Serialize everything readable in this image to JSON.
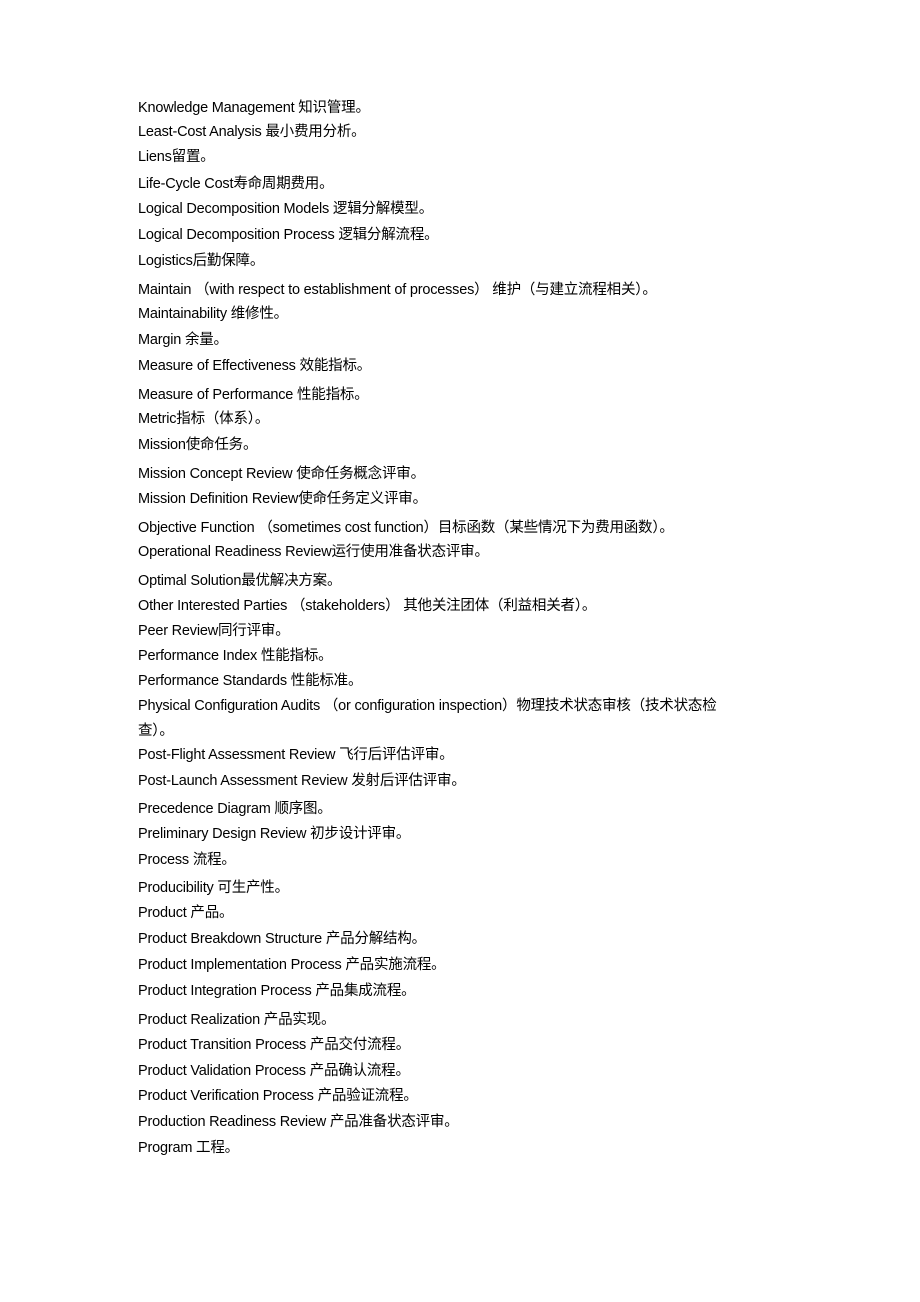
{
  "document": {
    "entries": [
      {
        "en": "Knowledge Management ",
        "zh": "知识管理。"
      },
      {
        "en": "Least-Cost Analysis ",
        "zh": "最小费用分析。"
      },
      {
        "en": "Liens",
        "zh": "留置。"
      },
      {
        "en": "Life-Cycle Cost",
        "zh": "寿命周期费用。"
      },
      {
        "en": "Logical Decomposition Models ",
        "zh": "逻辑分解模型。"
      },
      {
        "en": "Logical Decomposition Process ",
        "zh": "逻辑分解流程。"
      },
      {
        "en": "Logistics",
        "zh": "后勤保障。"
      },
      {
        "en": "Maintain （with respect to establishment of processes） ",
        "zh": "维护（与建立流程相关）。"
      },
      {
        "en": "Maintainability ",
        "zh": "维修性。"
      },
      {
        "en": "Margin ",
        "zh": "余量。"
      },
      {
        "en": "Measure of Effectiveness ",
        "zh": "效能指标。"
      },
      {
        "en": "Measure of Performance ",
        "zh": "性能指标。"
      },
      {
        "en": "Metric",
        "zh": "指标（体系）。"
      },
      {
        "en": "Mission",
        "zh": "使命任务。"
      },
      {
        "en": "Mission Concept Review ",
        "zh": "使命任务概念评审。"
      },
      {
        "en": "Mission Definition Review",
        "zh": "使命任务定义评审。"
      },
      {
        "en": "Objective Function （sometimes cost function）",
        "zh": "目标函数（某些情况下为费用函数）。"
      },
      {
        "en": "Operational Readiness Review",
        "zh": "运行使用准备状态评审。"
      },
      {
        "en": "Optimal Solution",
        "zh": "最优解决方案。"
      },
      {
        "en": "Other Interested Parties （stakeholders） ",
        "zh": "其他关注团体（利益相关者）。"
      },
      {
        "en": "Peer Review",
        "zh": "同行评审。"
      },
      {
        "en": "Performance Index ",
        "zh": "性能指标。"
      },
      {
        "en": "Performance Standards ",
        "zh": "性能标准。"
      },
      {
        "en": "Physical Configuration Audits （or configuration inspection）",
        "zh": "物理技术状态审核（技术状态检"
      },
      {
        "en": "",
        "zh": "查）。"
      },
      {
        "en": "Post-Flight Assessment Review ",
        "zh": "飞行后评估评审。"
      },
      {
        "en": "Post-Launch Assessment Review ",
        "zh": "发射后评估评审。"
      },
      {
        "en": "Precedence Diagram ",
        "zh": "顺序图。"
      },
      {
        "en": "Preliminary Design Review ",
        "zh": "初步设计评审。"
      },
      {
        "en": "Process ",
        "zh": "流程。"
      },
      {
        "en": "Producibility ",
        "zh": "可生产性。"
      },
      {
        "en": "Product ",
        "zh": "产品。"
      },
      {
        "en": "Product Breakdown Structure ",
        "zh": "产品分解结构。"
      },
      {
        "en": "Product Implementation Process ",
        "zh": "产品实施流程。"
      },
      {
        "en": "Product Integration Process ",
        "zh": "产品集成流程。"
      },
      {
        "en": "Product Realization ",
        "zh": "产品实现。"
      },
      {
        "en": "Product Transition Process ",
        "zh": "产品交付流程。"
      },
      {
        "en": "Product Validation Process ",
        "zh": "产品确认流程。"
      },
      {
        "en": "Product Verification Process ",
        "zh": "产品验证流程。"
      },
      {
        "en": "Production Readiness Review ",
        "zh": "产品准备状态评审。"
      },
      {
        "en": "Program ",
        "zh": "工程。"
      }
    ]
  }
}
